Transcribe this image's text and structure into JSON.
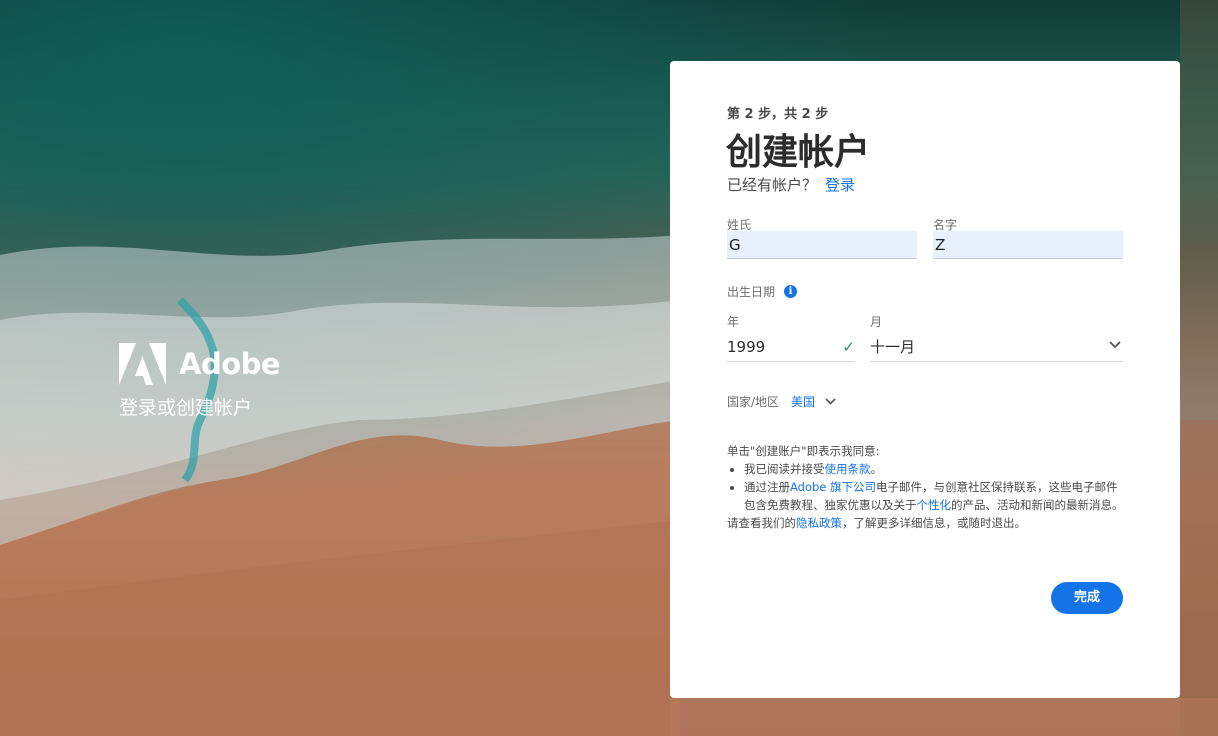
{
  "brand": {
    "name": "Adobe",
    "tagline": "登录或创建帐户",
    "logo_icon": "adobe-logo-icon"
  },
  "form": {
    "step": "第 2 步，共 2 步",
    "title": "创建帐户",
    "have_account": "已经有帐户？",
    "signin_link": "登录",
    "last_name": {
      "label": "姓氏",
      "value": "G"
    },
    "first_name": {
      "label": "名字",
      "value": "Z"
    },
    "dob_label": "出生日期",
    "year": {
      "label": "年",
      "value": "1999"
    },
    "month": {
      "label": "月",
      "value": "十一月"
    },
    "country_label": "国家/地区",
    "country_value": "美国",
    "legal": {
      "intro": "单击\"创建账户\"即表示我同意:",
      "b1_pre": "我已阅读并接受",
      "b1_link": "使用条款",
      "b1_post": "。",
      "b2_pre": "通过注册",
      "b2_link1": "Adobe 旗下公司",
      "b2_mid": "电子邮件，与创意社区保持联系，这些电子邮件包含免费教程、独家优惠以及关于",
      "b2_link2": "个性化",
      "b2_post": "的产品、活动和新闻的最新消息。",
      "footer_pre": "请查看我们的",
      "footer_link": "隐私政策",
      "footer_post": "，了解更多详细信息，或随时退出。"
    },
    "submit": "完成"
  },
  "colors": {
    "accent": "#1473e6",
    "check": "#268e6c",
    "autofill": "#e8f0fe"
  }
}
